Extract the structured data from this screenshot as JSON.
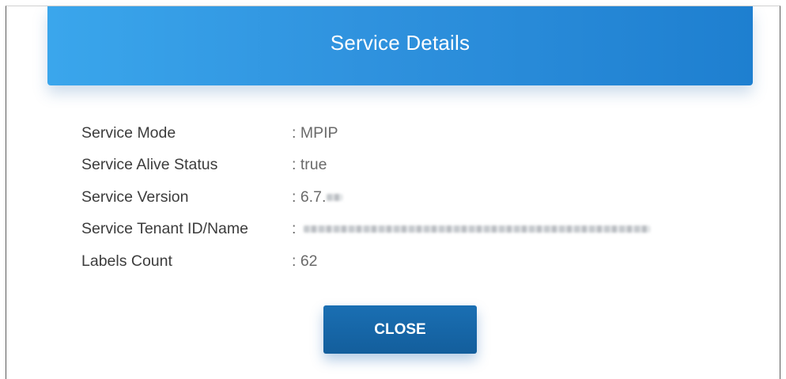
{
  "dialog": {
    "title": "Service Details",
    "rows": [
      {
        "label": "Service Mode",
        "value": ": MPIP"
      },
      {
        "label": "Service Alive Status",
        "value": ": true"
      },
      {
        "label": "Service Version",
        "value": ": 6.7."
      },
      {
        "label": "Service Tenant ID/Name",
        "value": ":"
      },
      {
        "label": "Labels Count",
        "value": ": 62"
      }
    ],
    "close_label": "CLOSE"
  },
  "colors": {
    "header_start": "#3aa6ec",
    "header_end": "#1e7fd0",
    "button": "#135e9c",
    "label_text": "#3c3c3c",
    "value_text": "#6a6a6a"
  }
}
